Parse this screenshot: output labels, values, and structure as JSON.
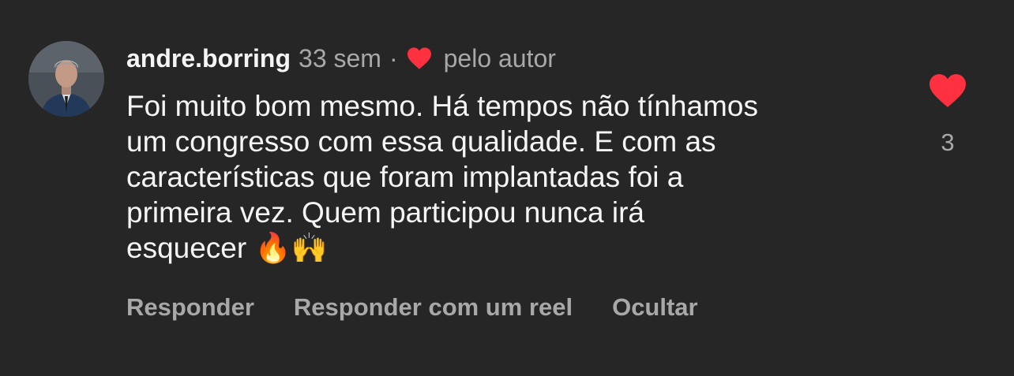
{
  "comment": {
    "username": "andre.borring",
    "time": "33 sem",
    "separator": "·",
    "author_liked_label": "pelo autor",
    "text": "Foi muito bom mesmo. Há tempos não tínhamos\num congresso com essa qualidade. E com as\ncaracterísticas que foram implantadas foi a\nprimeira vez. Quem participou nunca irá\nesquecer 🔥🙌",
    "like_count": "3",
    "avatar_icon": "user-avatar-icon",
    "heart_color": "#ff3040"
  },
  "actions": {
    "reply": "Responder",
    "reply_reel": "Responder com um reel",
    "hide": "Ocultar"
  }
}
